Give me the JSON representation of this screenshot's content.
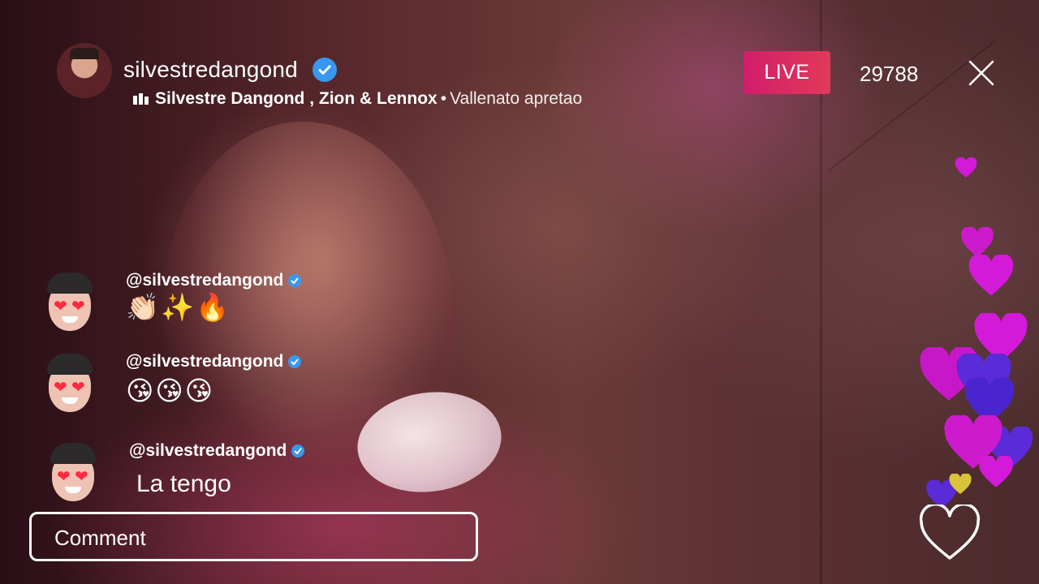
{
  "header": {
    "username": "silvestredangond",
    "music_artist": "Silvestre Dangond , Zion & Lennox",
    "music_separator": "•",
    "music_song": "Vallenato apretao",
    "live_label": "LIVE",
    "viewer_count": "29788"
  },
  "comments": [
    {
      "user": "@silvestredangond",
      "text": "👏🏻✨🔥"
    },
    {
      "user": "@silvestredangond",
      "text": "😘😘😘"
    },
    {
      "user": "@silvestredangond",
      "text": "La tengo"
    }
  ],
  "comment_input": {
    "placeholder": "Comment"
  },
  "colors": {
    "live_badge": "#e0245e",
    "verified": "#3897f0",
    "heart_magenta": "#d21ad8",
    "heart_purple": "#5a2bd6",
    "heart_yellow": "#d8c33a"
  },
  "icons": {
    "verified": "verified-icon",
    "music": "equalizer-icon",
    "close": "close-icon",
    "like": "heart-outline-icon"
  }
}
